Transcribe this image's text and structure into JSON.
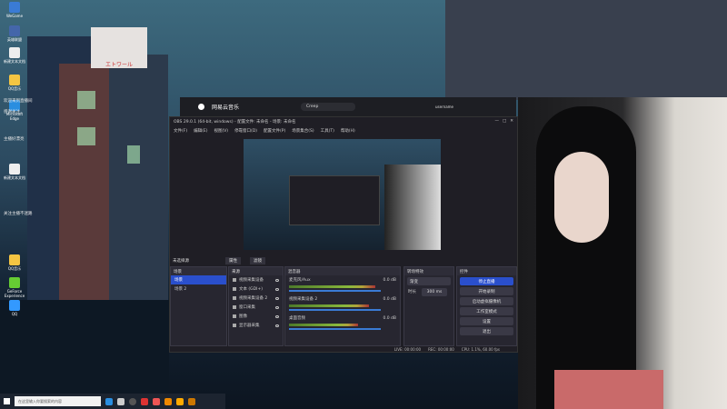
{
  "desktop": {
    "icons": [
      "WeGame",
      "英雄联盟",
      "新建文本文档",
      "QQ音乐",
      "Microsoft Edge",
      "新建文本文档",
      "QQ音乐",
      "GeForce Experience",
      "QQ"
    ],
    "chat": [
      "欢迎来到直播间",
      "感谢关注",
      "主播好漂亮",
      "关注主播不迷路"
    ],
    "sign_text": "エトワール"
  },
  "netease": {
    "title": "网易云音乐",
    "search": "Creep",
    "user": "username"
  },
  "obs": {
    "title": "OBS 29.0.1 (64-bit, windows) - 配置文件: 未命名 - 场景: 未命名",
    "window_controls": [
      "—",
      "□",
      "✕"
    ],
    "menu": [
      "文件(F)",
      "编辑(E)",
      "视图(V)",
      "停靠窗口(D)",
      "配置文件(P)",
      "场景集合(S)",
      "工具(T)",
      "帮助(H)"
    ],
    "toolbar": {
      "scene_label": "未选择源",
      "properties": "属性",
      "filters": "滤镜"
    },
    "scenes": {
      "title": "场景",
      "items": [
        "场景",
        "场景 2"
      ]
    },
    "sources": {
      "title": "来源",
      "items": [
        "视频采集设备",
        "文本 (GDI+)",
        "视频采集设备 2",
        "窗口采集",
        "图像",
        "显示器采集"
      ]
    },
    "mixer": {
      "title": "混音器",
      "channels": [
        {
          "name": "麦克风/Aux",
          "db": "0.0 dB",
          "level": 0.75
        },
        {
          "name": "视频采集设备 2",
          "db": "0.0 dB",
          "level": 0.7
        },
        {
          "name": "桌面音频",
          "db": "0.0 dB",
          "level": 0.6
        }
      ]
    },
    "transitions": {
      "title": "转场特效",
      "type": "渐变",
      "duration_label": "时长",
      "duration": "300 ms"
    },
    "controls": {
      "title": "控件",
      "buttons": [
        "停止直播",
        "开始录制",
        "启动虚拟摄像机",
        "工作室模式",
        "设置",
        "退出"
      ]
    },
    "status": {
      "live": "LIVE: 00:00:00",
      "rec": "REC: 00:00:00",
      "cpu": "CPU: 1.1%, 60.00 fps"
    }
  },
  "taskbar": {
    "search_placeholder": "在这里输入你要搜索的内容"
  }
}
